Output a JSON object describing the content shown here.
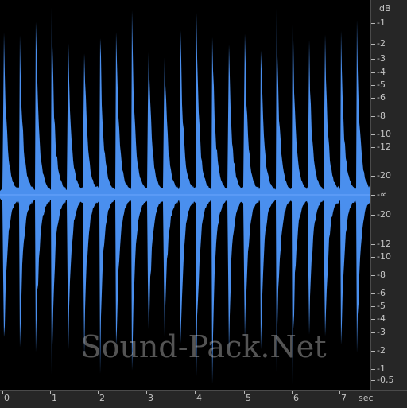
{
  "colors": {
    "waveform": "#4a8fee",
    "waveform_edge": "#6aa6ff",
    "background": "#000000",
    "ruler": "#262626",
    "ruler_text": "#c4c4c4"
  },
  "watermark": "Sound-Pack.Net",
  "db_axis": {
    "unit": "dB",
    "upper_labels": [
      "-1",
      "-2",
      "-3",
      "-4",
      "-5",
      "-6",
      "-8",
      "-10",
      "-12",
      "-20"
    ],
    "center_label": "-∞",
    "lower_labels": [
      "-20",
      "-12",
      "-10",
      "-8",
      "-6",
      "-5",
      "-4",
      "-3",
      "-2",
      "-1",
      "-0,5"
    ]
  },
  "time_axis": {
    "unit": "sec",
    "labels": [
      "0",
      "1",
      "2",
      "3",
      "4",
      "5",
      "6",
      "7"
    ]
  },
  "waveform": {
    "duration_sec": 7.55,
    "hits_per_second": 3,
    "peak_db": -0.5,
    "tail_db": -8
  }
}
